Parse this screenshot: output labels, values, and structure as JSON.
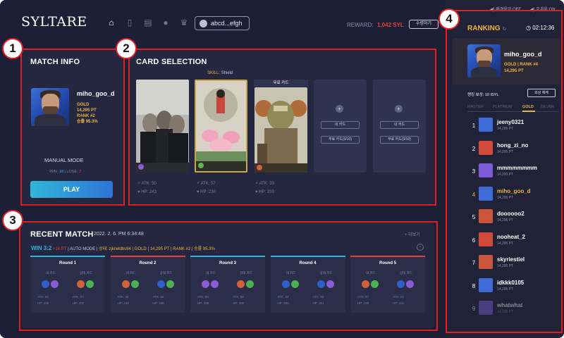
{
  "header": {
    "logo": "SYLTARE",
    "wallet": "abcd...efgh",
    "reward_label": "REWARD:",
    "reward_value": "1,042 SYL",
    "claim_label": "수령하기",
    "sound_effect": "효과음 ON",
    "bgm": "배경음악 OFF"
  },
  "match_info": {
    "title": "MATCH INFO",
    "player_name": "miho_goo_d",
    "tier": "GOLD",
    "points": "14,295 PT",
    "rank": "RANK #2",
    "win_rate": "승률 95.3%",
    "mode": "MANUAL MODE",
    "win_label": "WIN:",
    "win_value": "18",
    "lose_label": "LOSE:",
    "lose_value": "2",
    "play_label": "PLAY"
  },
  "card_selection": {
    "title": "CARD SELECTION",
    "skill_prefix": "SKILL:",
    "skill_value": "Shield",
    "free_card_label": "무료 카드",
    "cards": [
      {
        "atk": "ATK: 50",
        "hp": "HP: 243"
      },
      {
        "atk": "ATK: 57",
        "hp": "HP: 230"
      },
      {
        "atk": "ATK: 33",
        "hp": "HP: 230"
      }
    ],
    "empty_my_card": "내 카드",
    "empty_free_card": "무료 카드(3/10)"
  },
  "recent_match": {
    "title": "RECENT MATCH",
    "date": "2022. 2. 6. PM 6:34:48",
    "more": "더보기",
    "result": "WIN 3:2",
    "pt_change": "+16 PT",
    "mode": "AUTO MODE",
    "opponent": "상대: zjkrwldbs94",
    "opp_tier": "GOLD",
    "opp_pt": "14,295 PT",
    "opp_rank": "RANK #2",
    "opp_rate": "승률 95.3%",
    "rounds": [
      {
        "title": "Round 1",
        "left_tag": "내 카드",
        "right_tag": "상대 카드",
        "l_atk": "ATK: 60",
        "l_hp": "HP: 230",
        "r_atk": "ATK: 57",
        "r_hp": "HP: 230"
      },
      {
        "title": "Round 2",
        "left_tag": "내 카드",
        "right_tag": "상대 카드",
        "l_atk": "ATK: 38",
        "l_hp": "HP: 258",
        "r_atk": "ATK: 56",
        "r_hp": "HP: 268"
      },
      {
        "title": "Round 3",
        "left_tag": "내 카드",
        "right_tag": "상대 카드",
        "l_atk": "ATK: 60",
        "l_hp": "HP: 258",
        "r_atk": "ATK: 58",
        "r_hp": "HP: 250"
      },
      {
        "title": "Round 4",
        "left_tag": "내 카드",
        "right_tag": "상대 카드",
        "l_atk": "ATK: 34",
        "l_hp": "HP: 250",
        "r_atk": "ATK: 54",
        "r_hp": "HP: 261"
      },
      {
        "title": "Round 5",
        "left_tag": "내 카드",
        "right_tag": "상대 카드",
        "l_atk": "ATK: 57",
        "l_hp": "HP: 230",
        "r_atk": "ATK: 62",
        "r_hp": "HP: 241"
      }
    ]
  },
  "ranking": {
    "title": "RANKING",
    "timer": "02:12:36",
    "me": {
      "name": "miho_goo_d",
      "meta": "GOLD | RANK #4",
      "pt": "14,295 PT"
    },
    "reward_text": "랭킹 보상: 10 ISYL",
    "reward_btn": "보상 체계",
    "tiers": [
      "MASTER",
      "PLATINUM",
      "GOLD",
      "SILVER"
    ],
    "list": [
      {
        "rank": "1",
        "name": "jeeny0321",
        "pt": "14,295 PT"
      },
      {
        "rank": "2",
        "name": "hong_zi_no",
        "pt": "14,295 PT"
      },
      {
        "rank": "3",
        "name": "mmmmmmmm",
        "pt": "14,295 PT"
      },
      {
        "rank": "4",
        "name": "miho_goo_d",
        "pt": "14,295 PT"
      },
      {
        "rank": "5",
        "name": "doooooo2",
        "pt": "14,295 PT"
      },
      {
        "rank": "6",
        "name": "nooheat_2",
        "pt": "14,295 PT"
      },
      {
        "rank": "7",
        "name": "skyriestiel",
        "pt": "14,295 PT"
      },
      {
        "rank": "8",
        "name": "idkkk0105",
        "pt": "14,295 PT"
      },
      {
        "rank": "9",
        "name": "whatwhat",
        "pt": "14,295 PT"
      }
    ]
  },
  "markers": [
    "1",
    "2",
    "3",
    "4"
  ],
  "colors": {
    "accent_gold": "#f1b53b",
    "win_blue": "#2db5e6",
    "alert_red": "#e2403a",
    "annotation_red": "#e21f1f"
  }
}
